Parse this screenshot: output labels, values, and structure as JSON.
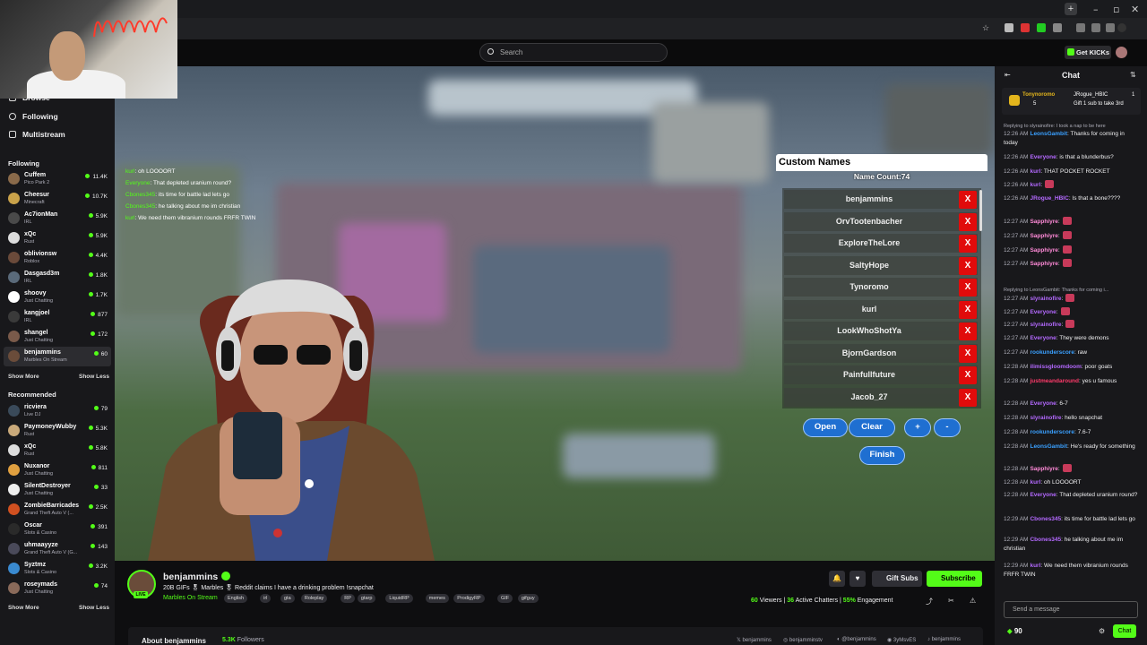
{
  "browser": {
    "minimize": "–",
    "maximize": "▫",
    "close": "✕",
    "new_tab": "+"
  },
  "header": {
    "search_placeholder": "Search",
    "get_kicks": "Get KICKs"
  },
  "sidebar": {
    "nav": [
      {
        "label": "Browse"
      },
      {
        "label": "Following"
      },
      {
        "label": "Multistream"
      }
    ],
    "following_title": "Following",
    "following": [
      {
        "name": "Cuffem",
        "game": "Pico Park 2",
        "viewers": "11.4K",
        "color": "#8a6a4a"
      },
      {
        "name": "Cheesur",
        "game": "Minecraft",
        "viewers": "10.7K",
        "color": "#c9a24a"
      },
      {
        "name": "Ac7ionMan",
        "game": "IRL",
        "viewers": "5.9K",
        "color": "#4a4a4a"
      },
      {
        "name": "xQc",
        "game": "Rust",
        "viewers": "5.9K",
        "color": "#dddddd"
      },
      {
        "name": "oblivionsw",
        "game": "Roblox",
        "viewers": "4.4K",
        "color": "#6a4a3a"
      },
      {
        "name": "Dasgasd3m",
        "game": "IRL",
        "viewers": "1.8K",
        "color": "#5a6a7a"
      },
      {
        "name": "shoovy",
        "game": "Just Chatting",
        "viewers": "1.7K",
        "color": "#ffffff"
      },
      {
        "name": "kangjoel",
        "game": "IRL",
        "viewers": "877",
        "color": "#3a3a3a"
      },
      {
        "name": "shangel",
        "game": "Just Chatting",
        "viewers": "172",
        "color": "#7a5a4a"
      },
      {
        "name": "benjammins",
        "game": "Marbles On Stream",
        "viewers": "60",
        "color": "#6a4c3a"
      }
    ],
    "show_more": "Show More",
    "show_less": "Show Less",
    "recommended_title": "Recommended",
    "recommended": [
      {
        "name": "ricviera",
        "game": "Live DJ",
        "viewers": "79",
        "color": "#3a4a5a"
      },
      {
        "name": "PaymoneyWubby",
        "game": "Rust",
        "viewers": "5.3K",
        "color": "#c9a97a"
      },
      {
        "name": "xQc",
        "game": "Rust",
        "viewers": "5.8K",
        "color": "#dddddd"
      },
      {
        "name": "Nuxanor",
        "game": "Just Chatting",
        "viewers": "811",
        "color": "#e0a040"
      },
      {
        "name": "SilentDestroyer",
        "game": "Just Chatting",
        "viewers": "33",
        "color": "#eeeeee"
      },
      {
        "name": "ZombieBarricades",
        "game": "Grand Theft Auto V (...",
        "viewers": "2.5K",
        "color": "#d05020"
      },
      {
        "name": "Oscar",
        "game": "Slots & Casino",
        "viewers": "391",
        "color": "#2a2a2a"
      },
      {
        "name": "uhmaayyze",
        "game": "Grand Theft Auto V (G...",
        "viewers": "143",
        "color": "#4a4a5a"
      },
      {
        "name": "Syztmz",
        "game": "Slots & Casino",
        "viewers": "3.2K",
        "color": "#3a8ad0"
      },
      {
        "name": "roseymads",
        "game": "Just Chatting",
        "viewers": "74",
        "color": "#8a6a5a"
      }
    ]
  },
  "overlay_chat": [
    {
      "user": "kurl",
      "text": "oh LOOOORT"
    },
    {
      "user": "Everyone",
      "text": "That depleted uranium round?"
    },
    {
      "user": "Cbones345",
      "text": "its time for battle lad lets go"
    },
    {
      "user": "Cbones345",
      "text": "he talking about me im christian"
    },
    {
      "user": "kurl",
      "text": "We need them vibranium rounds FRFR TWIN"
    }
  ],
  "custom_names": {
    "title": "Custom Names",
    "count": "Name Count:74",
    "names": [
      "benjammins",
      "OrvTootenbacher",
      "ExploreTheLore",
      "SaltyHope",
      "Tynoromo",
      "kurl",
      "LookWhoShotYa",
      "BjornGardson",
      "Painfullfuture",
      "Jacob_27"
    ],
    "remove": "X",
    "buttons": {
      "open": "Open",
      "clear": "Clear",
      "plus": "+",
      "minus": "-",
      "finish": "Finish"
    }
  },
  "channel": {
    "name": "benjammins",
    "live": "LIVE",
    "title": "20B GIFs 🎖 Marbles 🎖 Reddit claims I have a drinking problem !snapchat",
    "category": "Marbles On Stream",
    "tags": [
      "English",
      "irl",
      "gta",
      "Roleplay",
      "RP",
      "gtarp",
      "LiquidRP",
      "memes",
      "ProdigyRP",
      "GIF",
      "gifguy"
    ],
    "gift_subs": "Gift Subs",
    "subscribe": "Subscribe",
    "viewers": "60",
    "viewers_label": "Viewers",
    "chatters": "36",
    "chatters_label": "Active Chatters",
    "engagement": "55%",
    "engagement_label": "Engagement",
    "about": "About benjammins",
    "followers": "5.3K",
    "followers_label": "Followers",
    "socials": [
      "benjammins",
      "benjamminstv",
      "@benjammins",
      "3yMsvES",
      "benjammins"
    ]
  },
  "chat": {
    "title": "Chat",
    "pinned": {
      "user": "Tonynoromo",
      "count": "5",
      "user2": "JRogue_HBIC",
      "count2": "1",
      "text": "Gift 1 sub to take 3rd"
    },
    "messages": [
      {
        "time": "",
        "user": "Replying to slyrainofire: I took a nap to be here",
        "color": "#adadb8",
        "text": "",
        "reply": true
      },
      {
        "time": "12:26 AM",
        "user": "LeonsGambit",
        "color": "#3aa0ff",
        "text": ": Thanks for coming in today"
      },
      {
        "time": "12:26 AM",
        "user": "Everyone",
        "color": "#b469ff",
        "text": ": is that a blunderbus?"
      },
      {
        "time": "12:26 AM",
        "user": "kurl",
        "color": "#b469ff",
        "text": ": THAT POCKET ROCKET"
      },
      {
        "time": "12:26 AM",
        "user": "kurl",
        "color": "#b469ff",
        "text": ":"
      },
      {
        "time": "12:26 AM",
        "user": "JRogue_HBIC",
        "color": "#b469ff",
        "text": ": Is that a bone????"
      },
      {
        "time": "12:27 AM",
        "user": "Sapphiyre",
        "color": "#ff8ad8",
        "text": ":"
      },
      {
        "time": "12:27 AM",
        "user": "Sapphiyre",
        "color": "#ff8ad8",
        "text": ":"
      },
      {
        "time": "12:27 AM",
        "user": "Sapphiyre",
        "color": "#ff8ad8",
        "text": ":"
      },
      {
        "time": "12:27 AM",
        "user": "Sapphiyre",
        "color": "#ff8ad8",
        "text": ":"
      },
      {
        "time": "",
        "user": "Replying to LeonsGambit: Thanks for coming i...",
        "color": "#adadb8",
        "text": "",
        "reply": true
      },
      {
        "time": "12:27 AM",
        "user": "slyrainofire",
        "color": "#b469ff",
        "text": ":"
      },
      {
        "time": "12:27 AM",
        "user": "Everyone",
        "color": "#b469ff",
        "text": ":"
      },
      {
        "time": "12:27 AM",
        "user": "slyrainofire",
        "color": "#b469ff",
        "text": ":"
      },
      {
        "time": "12:27 AM",
        "user": "Everyone",
        "color": "#b469ff",
        "text": ": They were demons"
      },
      {
        "time": "12:27 AM",
        "user": "rookunderscore",
        "color": "#3aa0ff",
        "text": ": raw"
      },
      {
        "time": "12:28 AM",
        "user": "ilimissgloomdoom",
        "color": "#b469ff",
        "text": ": poor goats"
      },
      {
        "time": "12:28 AM",
        "user": "justmeandaround",
        "color": "#ff3a6a",
        "text": ": yes u famous"
      },
      {
        "time": "12:28 AM",
        "user": "Everyone",
        "color": "#b469ff",
        "text": ": 6-7"
      },
      {
        "time": "12:28 AM",
        "user": "slyrainofire",
        "color": "#b469ff",
        "text": ": hello snapchat"
      },
      {
        "time": "12:28 AM",
        "user": "rookunderscore",
        "color": "#3aa0ff",
        "text": ": 7.6-7"
      },
      {
        "time": "12:28 AM",
        "user": "LeonsGambit",
        "color": "#3aa0ff",
        "text": ": He's ready for something"
      },
      {
        "time": "12:28 AM",
        "user": "Sapphiyre",
        "color": "#ff8ad8",
        "text": ":"
      },
      {
        "time": "12:28 AM",
        "user": "kurl",
        "color": "#b469ff",
        "text": ": oh LOOOORT"
      },
      {
        "time": "12:28 AM",
        "user": "Everyone",
        "color": "#b469ff",
        "text": ": That depleted uranium round?"
      },
      {
        "time": "12:29 AM",
        "user": "Cbones345",
        "color": "#b469ff",
        "text": ": its time for battle lad lets go"
      },
      {
        "time": "12:29 AM",
        "user": "Cbones345",
        "color": "#b469ff",
        "text": ": he talking about me im christian"
      },
      {
        "time": "12:29 AM",
        "user": "kurl",
        "color": "#b469ff",
        "text": ": We need them vibranium rounds FRFR TWIN"
      }
    ],
    "input_placeholder": "Send a message",
    "points": "90",
    "send": "Chat"
  },
  "colors": {
    "accent": "#53fc18",
    "remove": "#e10b0b",
    "panel_button": "#1f6fd1"
  }
}
